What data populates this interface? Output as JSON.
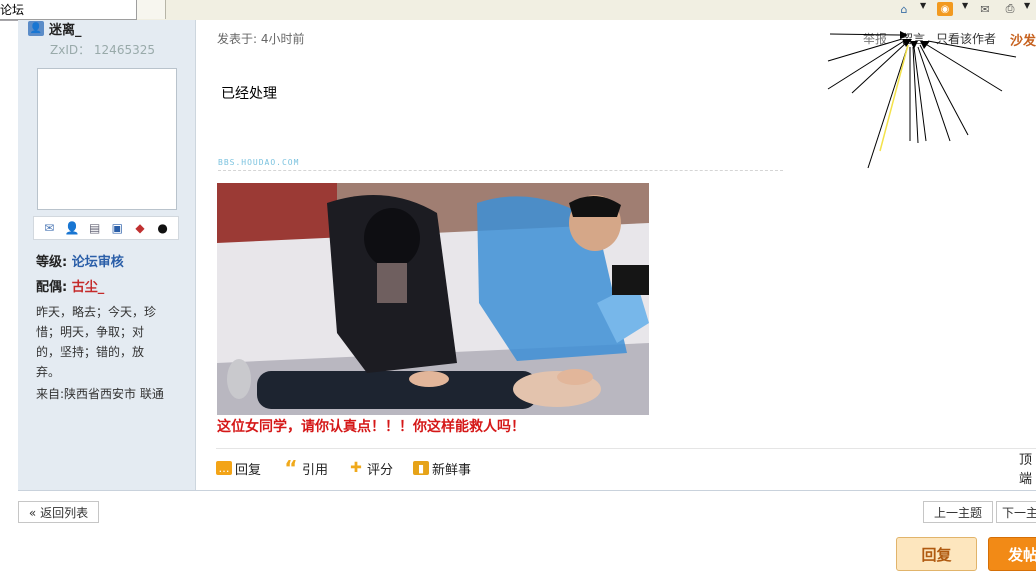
{
  "browser": {
    "tab_title": "论坛",
    "toolbar_icons": [
      "home-icon",
      "rss-icon",
      "mail-icon",
      "print-icon"
    ]
  },
  "user": {
    "name": "迷离_",
    "zxid": "ZxID： 12465325",
    "level_label": "等级:",
    "level_value": "论坛审核",
    "spouse_label": "配偶:",
    "spouse_value": "古尘_",
    "signature": "昨天，略去；今天，珍惜；明天，争取；对的，坚持；错的，放弃。",
    "from": "来自:陕西省西安市 联通",
    "action_icons": [
      "mail-icon",
      "add-friend-icon",
      "search-doc-icon",
      "profile-card-icon",
      "blocks-icon",
      "qq-icon"
    ]
  },
  "post": {
    "time": "发表于: 4小时前",
    "links": {
      "report": "举报",
      "message": "留言",
      "author_only": "只看该作者",
      "sofa": "沙发"
    },
    "text": "已经处理",
    "watermark": "BBS.HOUDAO.COM",
    "caption": "这位女同学，请你认真点！！！你这样能救人吗！",
    "actions": {
      "reply": "回复",
      "quote": "引用",
      "rate": "评分",
      "fresh": "新鲜事",
      "top": "顶端"
    }
  },
  "footer": {
    "back_to_list": "« 返回列表",
    "prev_topic": "上一主题",
    "next_topic": "下一主题",
    "reply_button": "回复",
    "post_button": "发帖"
  },
  "colors": {
    "sidebar_bg": "#e4ebf2",
    "link_blue": "#2a5ea8",
    "caption_red": "#d51818",
    "post_orange": "#f28a16"
  }
}
